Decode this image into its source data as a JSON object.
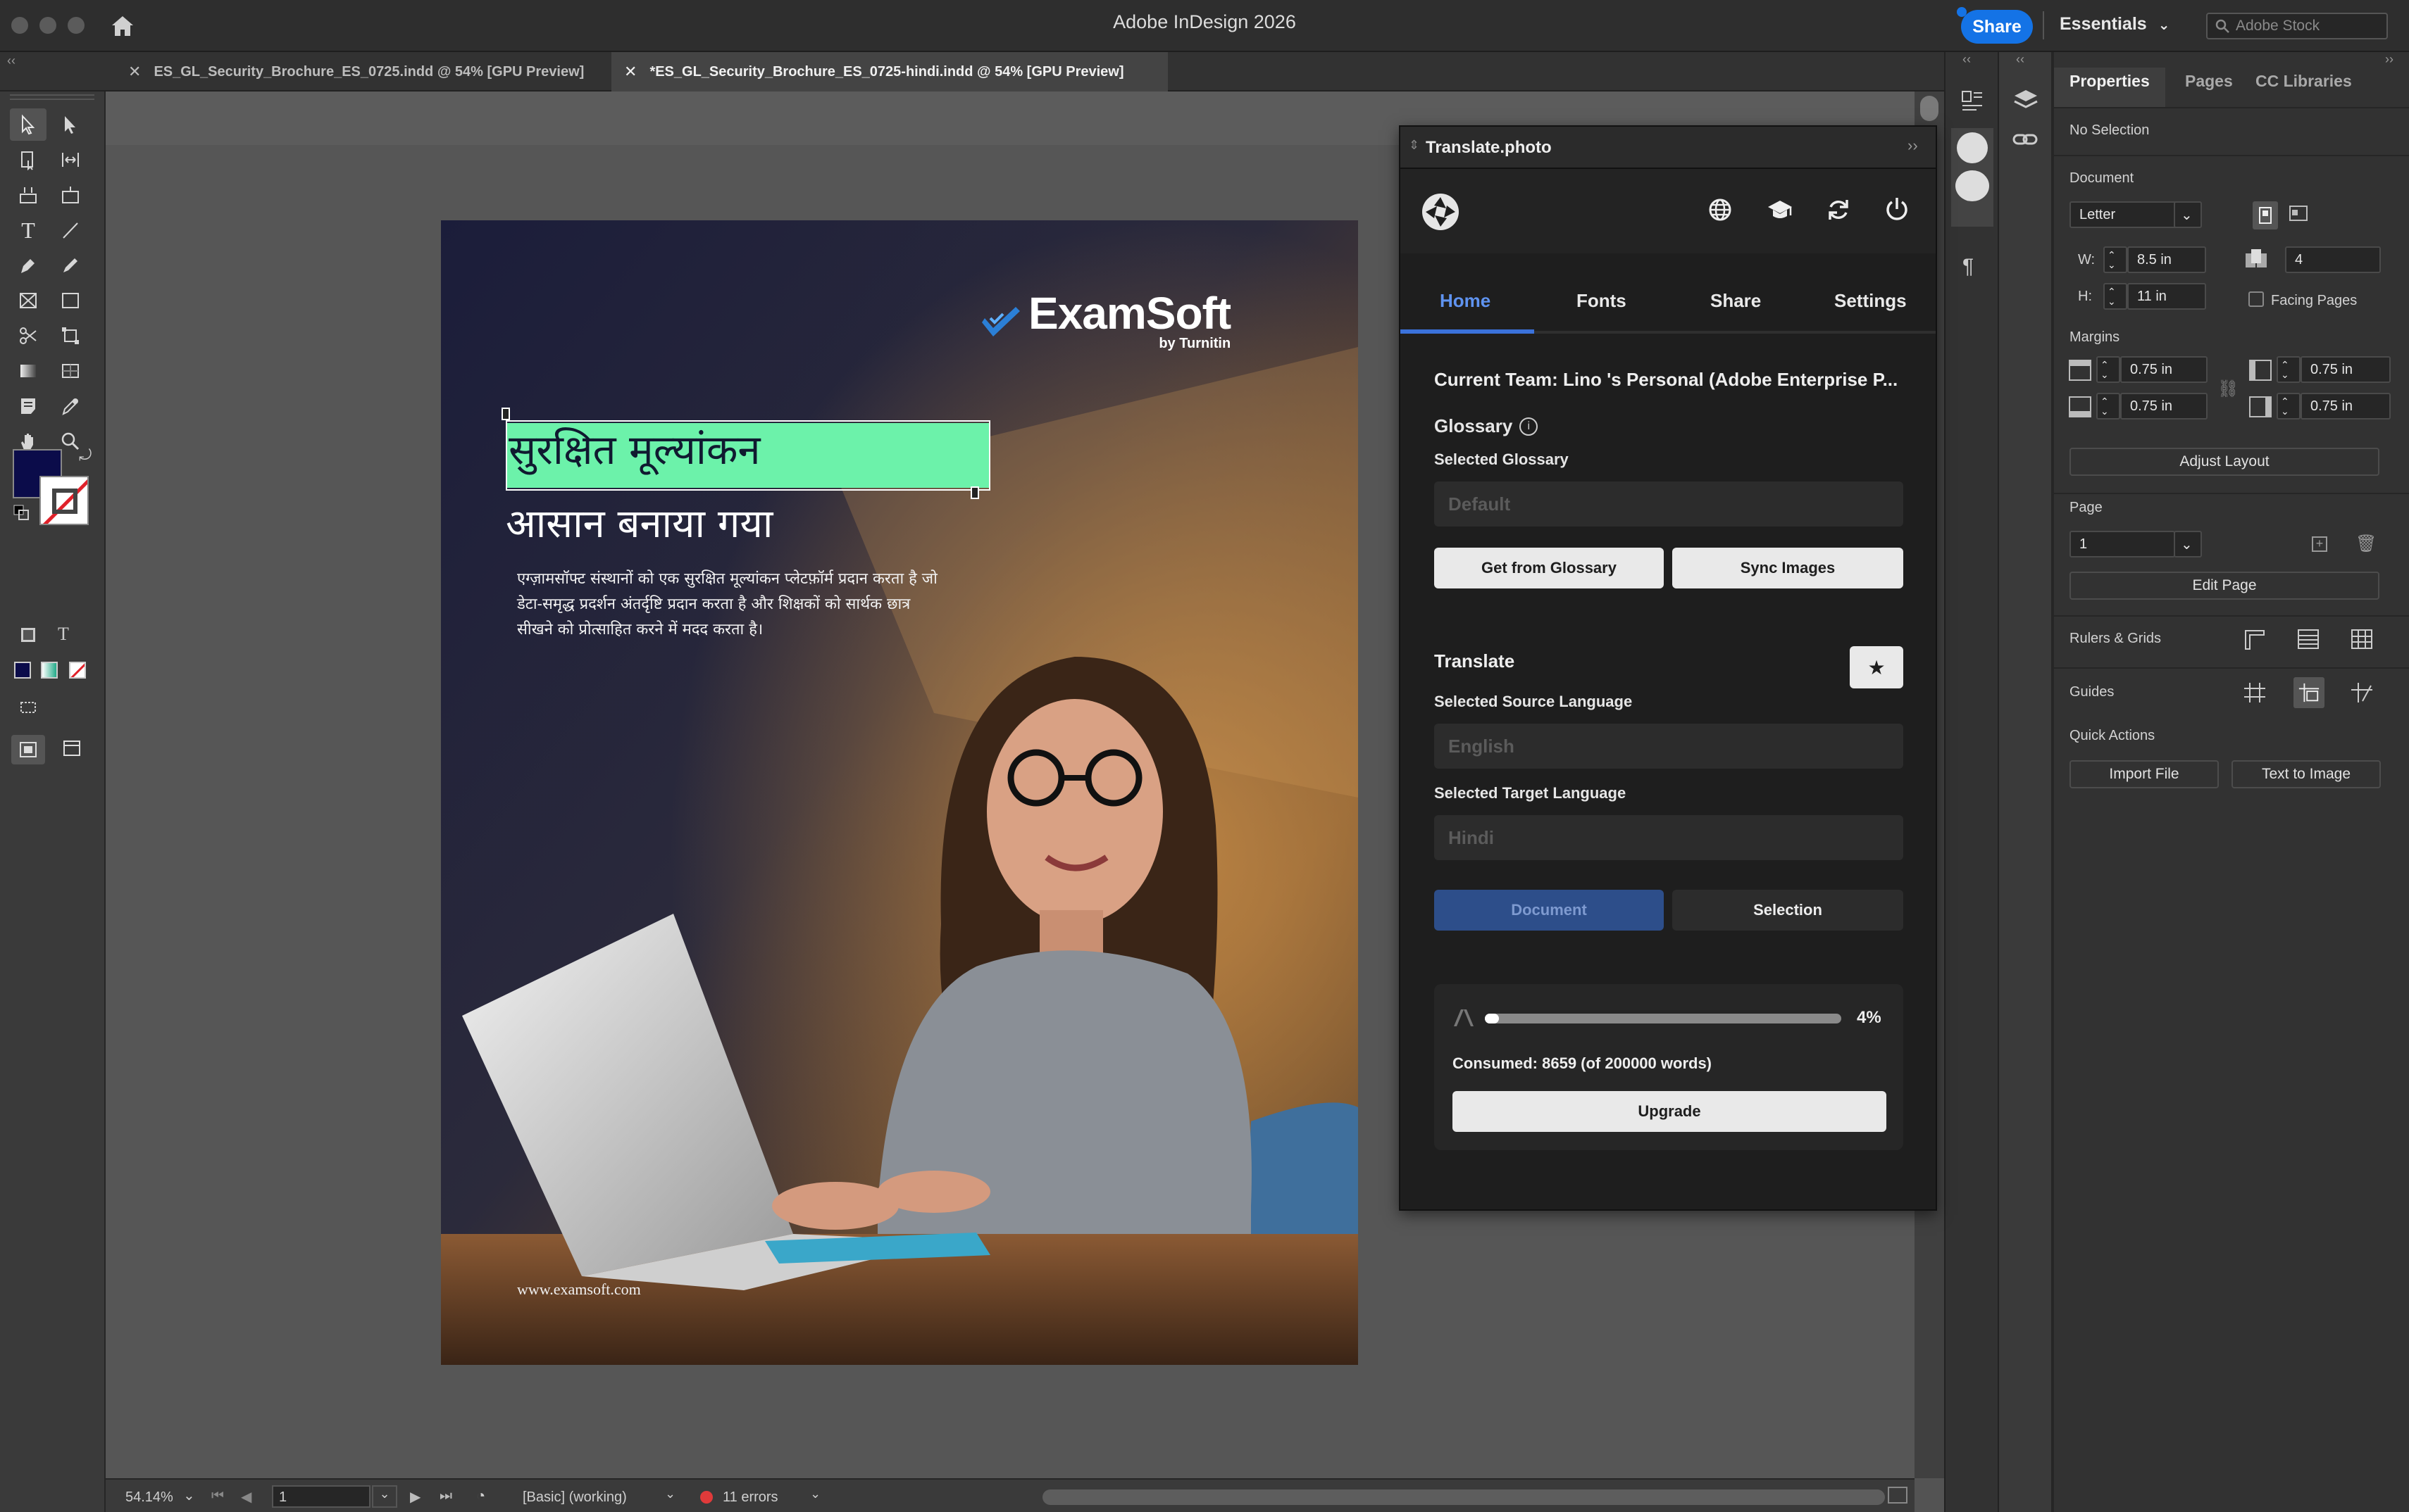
{
  "app": {
    "title": "Adobe InDesign 2026",
    "share_label": "Share",
    "workspace_label": "Essentials",
    "stock_placeholder": "Adobe Stock"
  },
  "tabs": [
    {
      "label": "ES_GL_Security_Brochure_ES_0725.indd @ 54% [GPU Preview]"
    },
    {
      "label": "*ES_GL_Security_Brochure_ES_0725-hindi.indd @ 54% [GPU Preview]"
    }
  ],
  "page": {
    "brand_name": "ExamSoft",
    "brand_sub": "by Turnitin",
    "headline_1": "सुरक्षित मूल्यांकन",
    "headline_2": "आसान बनाया गया",
    "body": "एग्ज़ामसॉफ्ट संस्थानों को एक सुरक्षित मूल्यांकन प्लेटफ़ॉर्म प्रदान करता है जो डेटा-समृद्ध प्रदर्शन अंतर्दृष्टि प्रदान करता है और शिक्षकों को सार्थक छात्र सीखने को प्रोत्साहित करने में मदद करता है।",
    "url": "www.examsoft.com",
    "highlight_color": "#6cf2aa"
  },
  "status": {
    "zoom": "54.14%",
    "page": "1",
    "preflight_profile": "[Basic] (working)",
    "errors": "11 errors",
    "error_color": "#e03a3a"
  },
  "translate": {
    "panel_title": "Translate.photo",
    "tabs": [
      "Home",
      "Fonts",
      "Share",
      "Settings"
    ],
    "active_tab": "Home",
    "team": "Current Team: Lino 's Personal (Adobe Enterprise P...",
    "glossary_heading": "Glossary",
    "selected_glossary_label": "Selected Glossary",
    "glossary_value": "Default",
    "get_glossary_label": "Get from Glossary",
    "sync_images_label": "Sync Images",
    "translate_heading": "Translate",
    "source_label": "Selected Source Language",
    "source_value": "English",
    "target_label": "Selected Target Language",
    "target_value": "Hindi",
    "document_label": "Document",
    "selection_label": "Selection",
    "usage_percent_label": "4%",
    "usage_fraction": 0.04,
    "consumed_text": "Consumed: 8659 (of 200000 words)",
    "upgrade_label": "Upgrade",
    "accent_color": "#2e61c9"
  },
  "properties": {
    "tabs": [
      "Properties",
      "Pages",
      "CC Libraries"
    ],
    "no_selection": "No Selection",
    "document_heading": "Document",
    "preset": "Letter",
    "w_label": "W:",
    "w_value": "8.5 in",
    "h_label": "H:",
    "h_value": "11 in",
    "pages_value": "4",
    "facing_pages_label": "Facing Pages",
    "margins_heading": "Margins",
    "margin_top": "0.75 in",
    "margin_bottom": "0.75 in",
    "margin_left": "0.75 in",
    "margin_right": "0.75 in",
    "adjust_layout_label": "Adjust Layout",
    "page_heading": "Page",
    "page_value": "1",
    "edit_page_label": "Edit Page",
    "rulers_grids_label": "Rulers & Grids",
    "guides_label": "Guides",
    "quick_actions_heading": "Quick Actions",
    "import_file_label": "Import File",
    "text_to_image_label": "Text to Image"
  }
}
